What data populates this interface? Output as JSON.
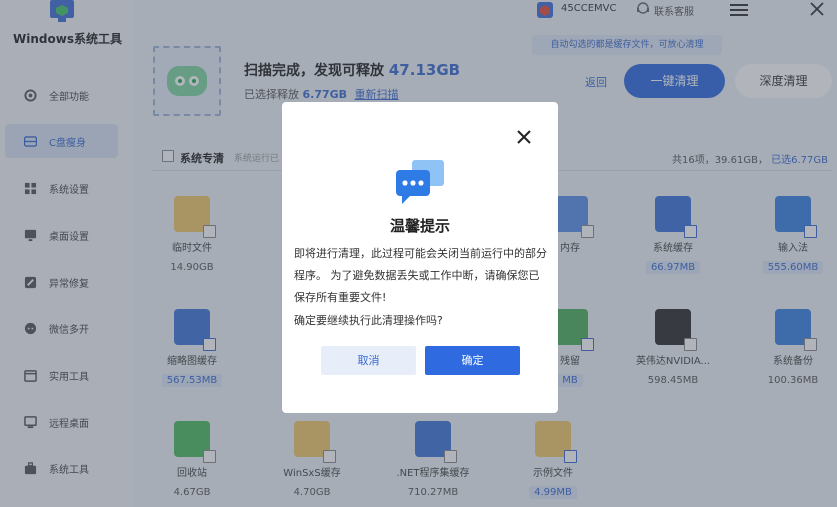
{
  "app": {
    "title": "Windows系统工具"
  },
  "topbar": {
    "account": "45CCEMVC",
    "support": "联系客服"
  },
  "nav": [
    {
      "label": "全部功能",
      "icon": "gear-icon"
    },
    {
      "label": "C盘瘦身",
      "icon": "disk-icon"
    },
    {
      "label": "系统设置",
      "icon": "grid-icon"
    },
    {
      "label": "桌面设置",
      "icon": "desktop-icon"
    },
    {
      "label": "异常修复",
      "icon": "wrench-icon"
    },
    {
      "label": "微信多开",
      "icon": "chat-icon"
    },
    {
      "label": "实用工具",
      "icon": "calendar-icon"
    },
    {
      "label": "远程桌面",
      "icon": "monitor-icon"
    },
    {
      "label": "系统工具",
      "icon": "toolbox-icon"
    }
  ],
  "header": {
    "scan_prefix": "扫描完成，发现可释放",
    "scan_amount": "47.13GB",
    "selected_prefix": "已选择释放",
    "selected_amount": "6.77GB",
    "rescan": "重新扫描",
    "tip": "自动勾选的都是缓存文件，可放心清理",
    "back": "返回",
    "one_click": "一键清理",
    "deep_clean": "深度清理"
  },
  "list": {
    "title": "系统专清",
    "subtitle": "系统运行已",
    "summary_prefix": "共16项，39.61GB",
    "summary_selected": "已选6.77GB"
  },
  "items": [
    {
      "name": "临时文件",
      "size": "14.90GB",
      "selected": false
    },
    {
      "name": "内存",
      "size": "",
      "selected": false
    },
    {
      "name": "系统缓存",
      "size": "66.97MB",
      "selected": true
    },
    {
      "name": "输入法",
      "size": "555.60MB",
      "selected": true
    },
    {
      "name": "缩略图缓存",
      "size": "567.53MB",
      "selected": true
    },
    {
      "name": "残留",
      "size": "MB",
      "selected": true
    },
    {
      "name": "英伟达NVIDIA...",
      "size": "598.45MB",
      "selected": false
    },
    {
      "name": "系统备份",
      "size": "100.36MB",
      "selected": false
    },
    {
      "name": "回收站",
      "size": "4.67GB",
      "selected": false
    },
    {
      "name": "WinSxS缓存",
      "size": "4.70GB",
      "selected": false
    },
    {
      "name": ".NET程序集缓存",
      "size": "710.27MB",
      "selected": false
    },
    {
      "name": "示例文件",
      "size": "4.99MB",
      "selected": true
    }
  ],
  "modal": {
    "title": "温馨提示",
    "body": "即将进行清理，此过程可能会关闭当前运行中的部分程序。 为了避免数据丢失或工作中断，请确保您已保存所有重要文件!",
    "confirm": "确定要继续执行此清理操作吗?",
    "cancel": "取消",
    "ok": "确定"
  }
}
